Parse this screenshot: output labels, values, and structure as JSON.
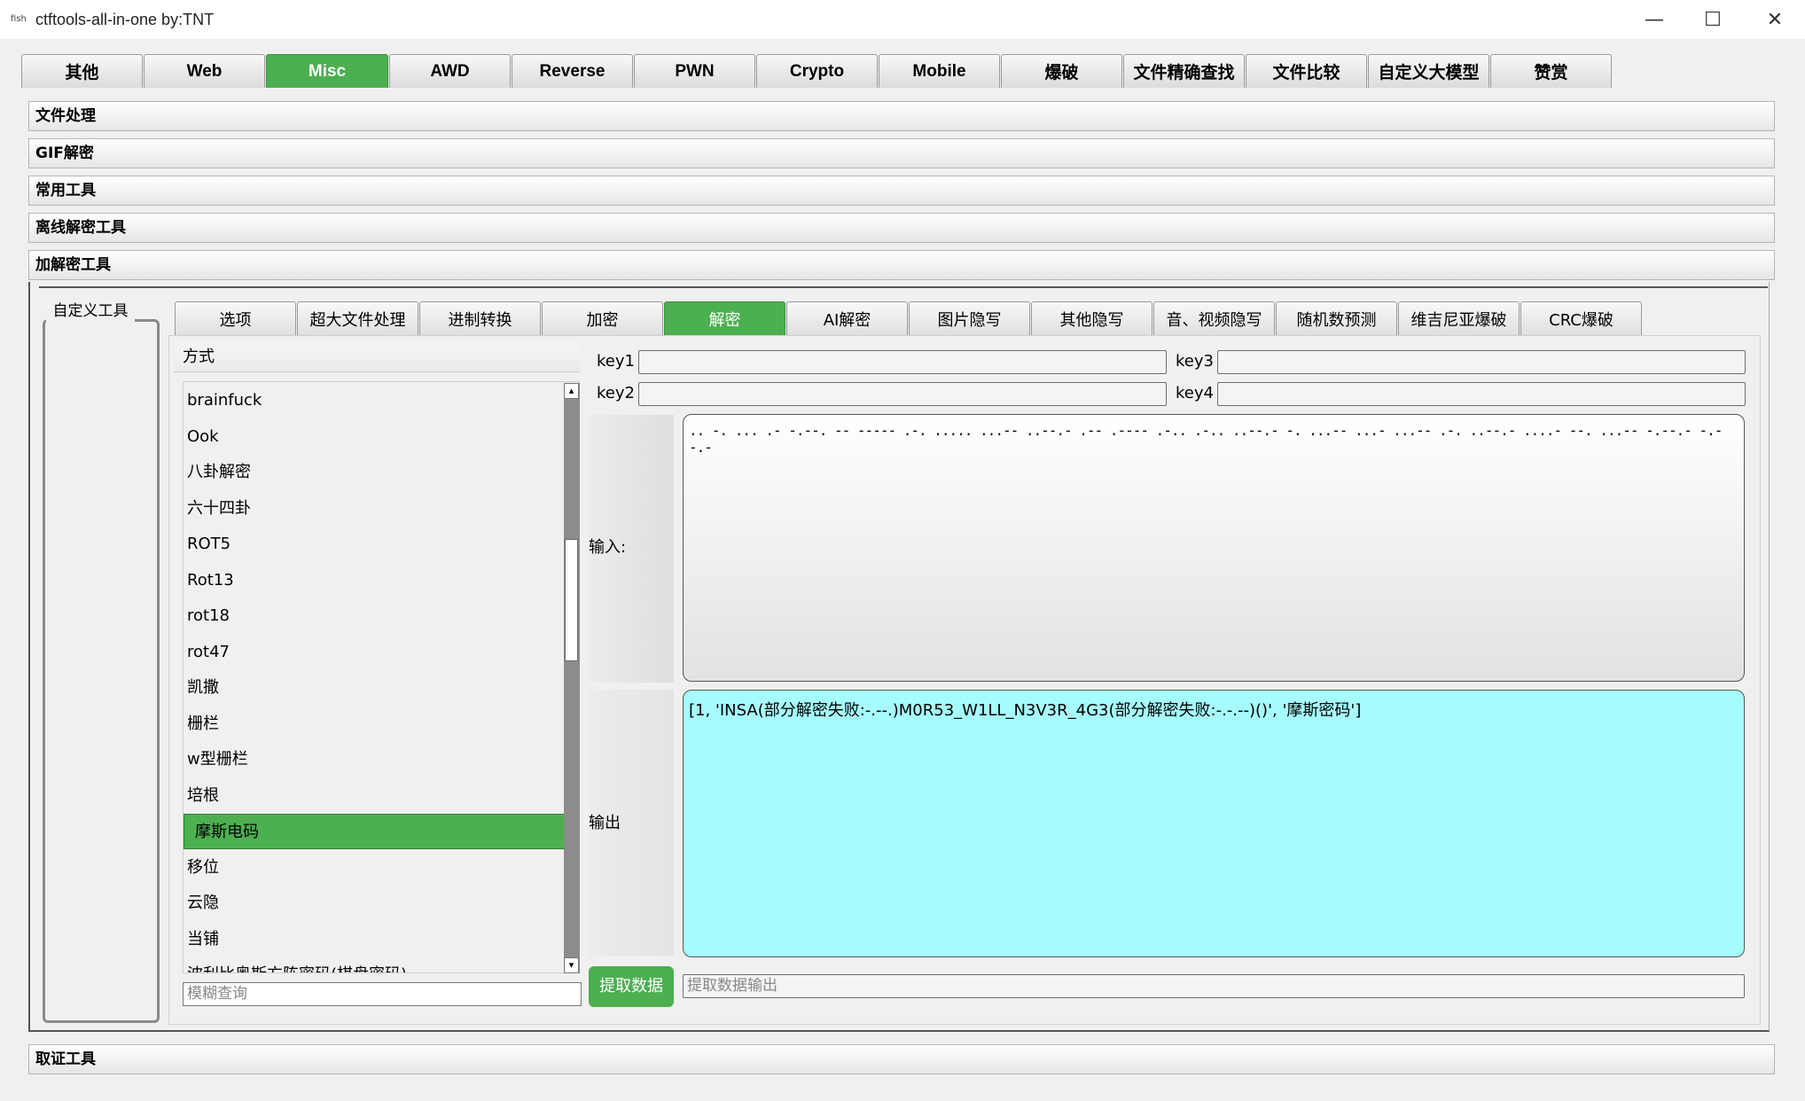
{
  "window": {
    "app_icon_text": "fish",
    "title": "ctftools-all-in-one   by:TNT",
    "minimize_glyph": "—",
    "maximize_glyph": "☐",
    "close_glyph": "✕"
  },
  "main_tabs": [
    "其他",
    "Web",
    "Misc",
    "AWD",
    "Reverse",
    "PWN",
    "Crypto",
    "Mobile",
    "爆破",
    "文件精确查找",
    "文件比较",
    "自定义大模型",
    "赞赏"
  ],
  "main_tabs_active": "Misc",
  "sections": [
    "文件处理",
    "GIF解密",
    "常用工具",
    "离线解密工具",
    "加解密工具"
  ],
  "left_panel": {
    "title": "自定义工具"
  },
  "sub_tabs": [
    "选项",
    "超大文件处理",
    "进制转换",
    "加密",
    "解密",
    "AI解密",
    "图片隐写",
    "其他隐写",
    "音、视频隐写",
    "随机数预测",
    "维吉尼亚爆破",
    "CRC爆破"
  ],
  "sub_tabs_active": "解密",
  "method": {
    "header": "方式",
    "items": [
      "brainfuck",
      "Ook",
      "八卦解密",
      "六十四卦",
      "ROT5",
      "Rot13",
      "rot18",
      "rot47",
      "凯撒",
      "栅栏",
      "w型栅栏",
      "培根",
      "摩斯电码",
      "移位",
      "云隐",
      "当铺",
      "波利比奥斯方阵密码(棋盘密码)"
    ],
    "selected": "摩斯电码",
    "search_placeholder": "模糊查询",
    "scroll_up_glyph": "▴",
    "scroll_down_glyph": "▾"
  },
  "keys": {
    "key1": "key1",
    "key2": "key2",
    "key3": "key3",
    "key4": "key4"
  },
  "input": {
    "label": "输入:",
    "value": ".. -. ... .- -.--. -- ----- .-. ..... ...-- ..--.- .-- .---- .-.. .-.. ..--.- -. ...-- ...- ...-- .-. ..--.- ....- --. ...-- -.--.- -.--.-"
  },
  "output": {
    "label": "输出",
    "value": "[1, 'INSA(部分解密失败:-.--.)M0R53_W1LL_N3V3R_4G3(部分解密失败:-.-.--)()', '摩斯密码']"
  },
  "extract": {
    "button_label": "提取数据",
    "output_placeholder": "提取数据输出"
  },
  "forensics_section": "取证工具",
  "colors": {
    "accent": "#4caf50",
    "output_bg": "#a6fcfd"
  }
}
